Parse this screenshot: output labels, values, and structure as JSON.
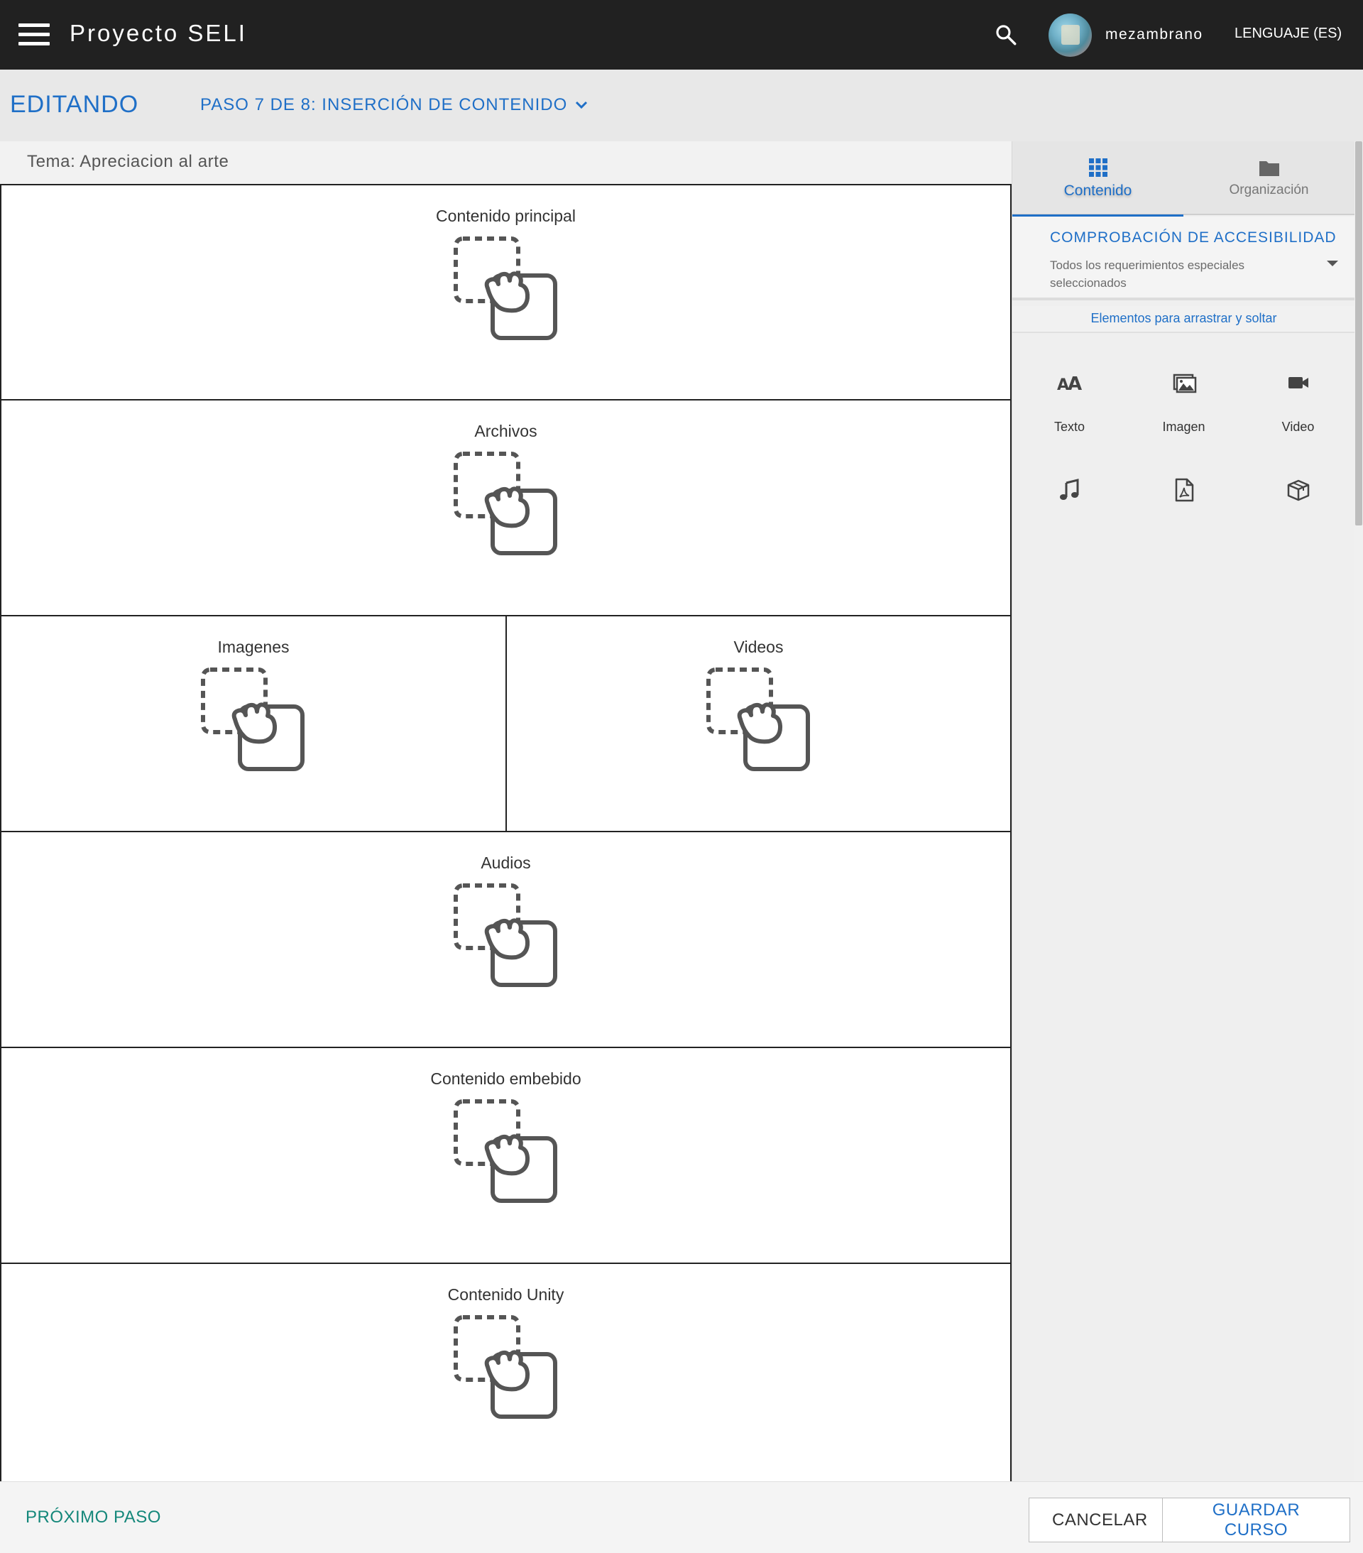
{
  "appbar": {
    "title": "Proyecto SELI",
    "username": "mezambrano",
    "language_label": "LENGUAJE (ES)",
    "icons": {
      "menu": "hamburger-menu-icon",
      "search": "search-icon"
    }
  },
  "subheader": {
    "mode": "EDITANDO",
    "step": "PASO 7 DE 8: INSERCIÓN DE CONTENIDO"
  },
  "topic": "Tema: Apreciacion al arte",
  "zones": [
    {
      "title": "Contenido principal"
    },
    {
      "title": "Archivos"
    },
    {
      "title": "Imagenes"
    },
    {
      "title": "Videos"
    },
    {
      "title": "Audios"
    },
    {
      "title": "Contenido embebido"
    },
    {
      "title": "Contenido Unity"
    }
  ],
  "panel": {
    "tabs": [
      {
        "label": "Contenido",
        "icon": "grid-icon",
        "active": true
      },
      {
        "label": "Organización",
        "icon": "folder-icon",
        "active": false
      }
    ],
    "accessibility": {
      "title": "COMPROBACIÓN DE ACCESIBILIDAD",
      "subtitle": "Todos los requerimientos especiales seleccionados"
    },
    "dnd_label": "Elementos para arrastrar y soltar",
    "tools": [
      {
        "label": "Texto",
        "icon": "text-size-icon"
      },
      {
        "label": "Imagen",
        "icon": "image-icon"
      },
      {
        "label": "Video",
        "icon": "video-camera-icon"
      },
      {
        "label": "",
        "icon": "music-note-icon"
      },
      {
        "label": "",
        "icon": "pdf-file-icon"
      },
      {
        "label": "",
        "icon": "3d-box-icon"
      }
    ]
  },
  "footer": {
    "next": "PRÓXIMO PASO",
    "cancel": "CANCELAR",
    "save": "GUARDAR CURSO"
  },
  "colors": {
    "appbar": "#212121",
    "accent": "#1f6fc7",
    "next": "#14877a",
    "subheader": "#e8e8e8"
  }
}
